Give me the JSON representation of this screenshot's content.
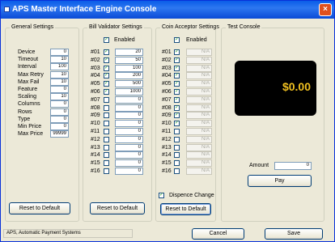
{
  "window": {
    "title": "APS Master Interface Engine Console",
    "close_glyph": "×"
  },
  "general": {
    "title": "General Settings",
    "rows": [
      {
        "label": "Device",
        "value": "0"
      },
      {
        "label": "Timeout",
        "value": "10"
      },
      {
        "label": "Interval",
        "value": "100"
      },
      {
        "label": "Max Retry",
        "value": "10"
      },
      {
        "label": "Max Fail",
        "value": "10"
      },
      {
        "label": "Feature",
        "value": "0"
      },
      {
        "label": "Scaling",
        "value": "10"
      },
      {
        "label": "Columns",
        "value": "0"
      },
      {
        "label": "Rows",
        "value": "0"
      },
      {
        "label": "Type",
        "value": "0"
      },
      {
        "label": "Min Price",
        "value": "0"
      },
      {
        "label": "Max Price",
        "value": "99999"
      }
    ],
    "reset_label": "Reset to Default"
  },
  "bill": {
    "title": "Bill Validator Settings",
    "enabled_label": "Enabled",
    "enabled": true,
    "rows": [
      {
        "label": "#01",
        "checked": true,
        "value": "20"
      },
      {
        "label": "#02",
        "checked": true,
        "value": "50"
      },
      {
        "label": "#03",
        "checked": true,
        "value": "100"
      },
      {
        "label": "#04",
        "checked": true,
        "value": "200"
      },
      {
        "label": "#05",
        "checked": true,
        "value": "500"
      },
      {
        "label": "#06",
        "checked": true,
        "value": "1000"
      },
      {
        "label": "#07",
        "checked": false,
        "value": "0"
      },
      {
        "label": "#08",
        "checked": false,
        "value": "0"
      },
      {
        "label": "#09",
        "checked": false,
        "value": "0"
      },
      {
        "label": "#10",
        "checked": false,
        "value": "0"
      },
      {
        "label": "#11",
        "checked": false,
        "value": "0"
      },
      {
        "label": "#12",
        "checked": false,
        "value": "0"
      },
      {
        "label": "#13",
        "checked": false,
        "value": "0"
      },
      {
        "label": "#14",
        "checked": false,
        "value": "0"
      },
      {
        "label": "#15",
        "checked": false,
        "value": "0"
      },
      {
        "label": "#16",
        "checked": false,
        "value": "0"
      }
    ],
    "reset_label": "Reset to Default"
  },
  "coin": {
    "title": "Coin Acceptor Settings",
    "enabled_label": "Enabled",
    "enabled": true,
    "rows": [
      {
        "label": "#01",
        "checked": true,
        "value": "N/A"
      },
      {
        "label": "#02",
        "checked": true,
        "value": "N/A"
      },
      {
        "label": "#03",
        "checked": true,
        "value": "N/A"
      },
      {
        "label": "#04",
        "checked": true,
        "value": "N/A"
      },
      {
        "label": "#05",
        "checked": true,
        "value": "N/A"
      },
      {
        "label": "#06",
        "checked": true,
        "value": "N/A"
      },
      {
        "label": "#07",
        "checked": true,
        "value": "N/A"
      },
      {
        "label": "#08",
        "checked": true,
        "value": "N/A"
      },
      {
        "label": "#09",
        "checked": true,
        "value": "N/A"
      },
      {
        "label": "#10",
        "checked": true,
        "value": "N/A"
      },
      {
        "label": "#11",
        "checked": false,
        "value": "N/A"
      },
      {
        "label": "#12",
        "checked": false,
        "value": "N/A"
      },
      {
        "label": "#13",
        "checked": false,
        "value": "N/A"
      },
      {
        "label": "#14",
        "checked": false,
        "value": "N/A"
      },
      {
        "label": "#15",
        "checked": false,
        "value": "N/A"
      },
      {
        "label": "#16",
        "checked": false,
        "value": "N/A"
      }
    ],
    "dispense_label": "Dispence Change",
    "dispense_checked": true,
    "reset_label": "Reset to Default"
  },
  "test": {
    "title": "Test Console",
    "display_value": "$0.00",
    "amount_label": "Amount",
    "amount_value": "0",
    "pay_label": "Pay"
  },
  "footer": {
    "status": "APS, Automatic Payment Systems",
    "cancel_label": "Cancel",
    "save_label": "Save"
  },
  "colors": {
    "titlebar": "#0a5de8",
    "display_bg": "#000000",
    "display_text": "#f0c020",
    "check": "#21a121"
  }
}
